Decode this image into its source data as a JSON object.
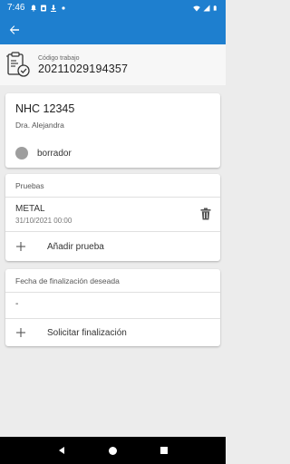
{
  "status_bar": {
    "time": "7:46",
    "left_icons": [
      "notification-icon",
      "sim-icon",
      "download-icon",
      "dot-icon"
    ],
    "right_icons": [
      "wifi-icon",
      "signal-icon",
      "battery-icon"
    ]
  },
  "app_bar": {
    "back_icon": "arrow-back-icon",
    "color": "#1e7fcf"
  },
  "header": {
    "label": "Código trabajo",
    "code": "20211029194357",
    "icon": "clipboard-check-icon"
  },
  "patient": {
    "nhc": "NHC 12345",
    "doctor": "Dra. Alejandra",
    "status": "borrador",
    "status_color": "#9e9e9e"
  },
  "pruebas": {
    "title": "Pruebas",
    "items": [
      {
        "name": "METAL",
        "date": "31/10/2021 00:00",
        "action_icon": "trash-icon"
      }
    ],
    "add_label": "Añadir prueba"
  },
  "fecha": {
    "title": "Fecha de finalización deseada",
    "value": "-",
    "action_label": "Solicitar finalización"
  },
  "nav_bar": {
    "icons": [
      "back-triangle-icon",
      "home-circle-icon",
      "recents-square-icon"
    ]
  }
}
